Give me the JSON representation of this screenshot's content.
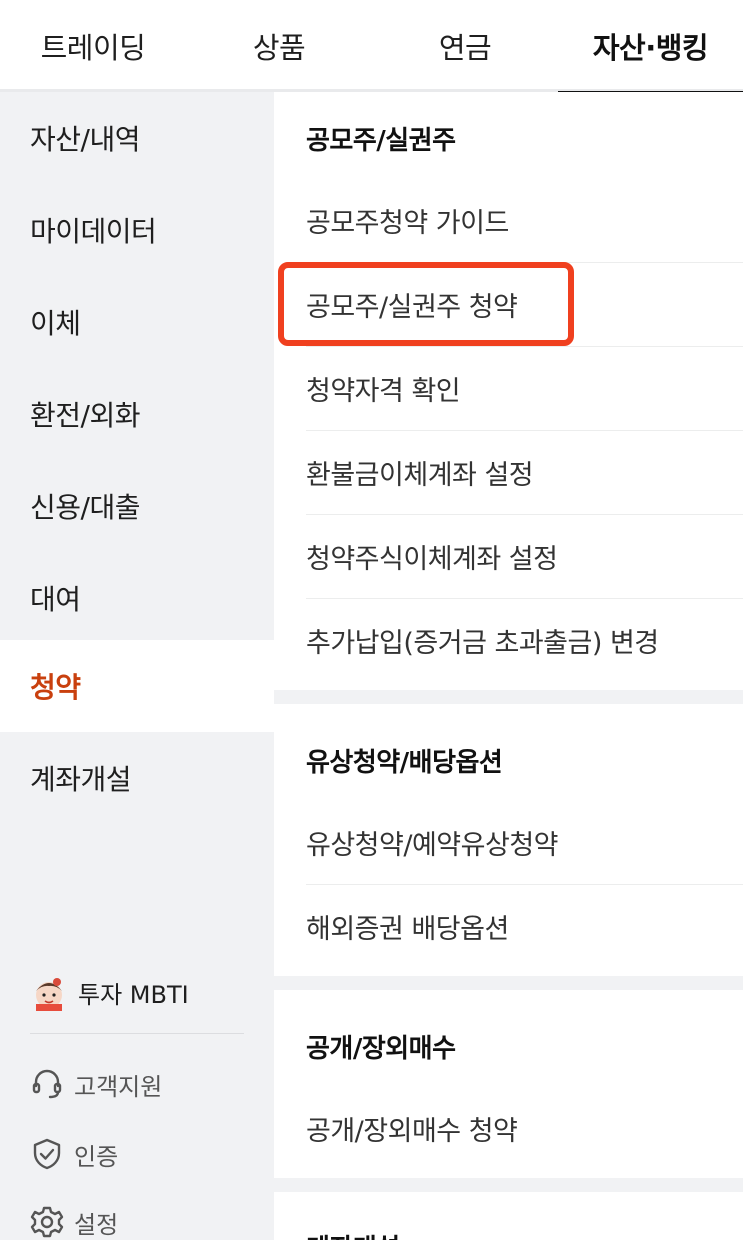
{
  "top_tabs": [
    {
      "label": "트레이딩",
      "active": false
    },
    {
      "label": "상품",
      "active": false
    },
    {
      "label": "연금",
      "active": false
    },
    {
      "label": "자산·뱅킹",
      "active": true
    }
  ],
  "sidebar": {
    "items": [
      {
        "label": "자산/내역"
      },
      {
        "label": "마이데이터"
      },
      {
        "label": "이체"
      },
      {
        "label": "환전/외화"
      },
      {
        "label": "신용/대출"
      },
      {
        "label": "대여"
      },
      {
        "label": "청약",
        "active": true
      },
      {
        "label": "계좌개설"
      }
    ],
    "mbti_label": "투자 MBTI",
    "support_label": "고객지원",
    "auth_label": "인증",
    "settings_label": "설정"
  },
  "sections": [
    {
      "title": "공모주/실권주",
      "items": [
        "공모주청약 가이드",
        "공모주/실권주 청약",
        "청약자격 확인",
        "환불금이체계좌 설정",
        "청약주식이체계좌 설정",
        "추가납입(증거금 초과출금) 변경"
      ]
    },
    {
      "title": "유상청약/배당옵션",
      "items": [
        "유상청약/예약유상청약",
        "해외증권 배당옵션"
      ]
    },
    {
      "title": "공개/장외매수",
      "items": [
        "공개/장외매수 청약"
      ]
    },
    {
      "title": "계좌개설",
      "items": []
    }
  ],
  "colors": {
    "active_sidebar_text": "#c9400e",
    "highlight_border": "#f0401f",
    "sidebar_bg": "#f1f2f4"
  },
  "icons": {
    "mbti": "character-avatar-icon",
    "support": "headset-icon",
    "auth": "shield-check-icon",
    "settings": "gear-icon"
  }
}
